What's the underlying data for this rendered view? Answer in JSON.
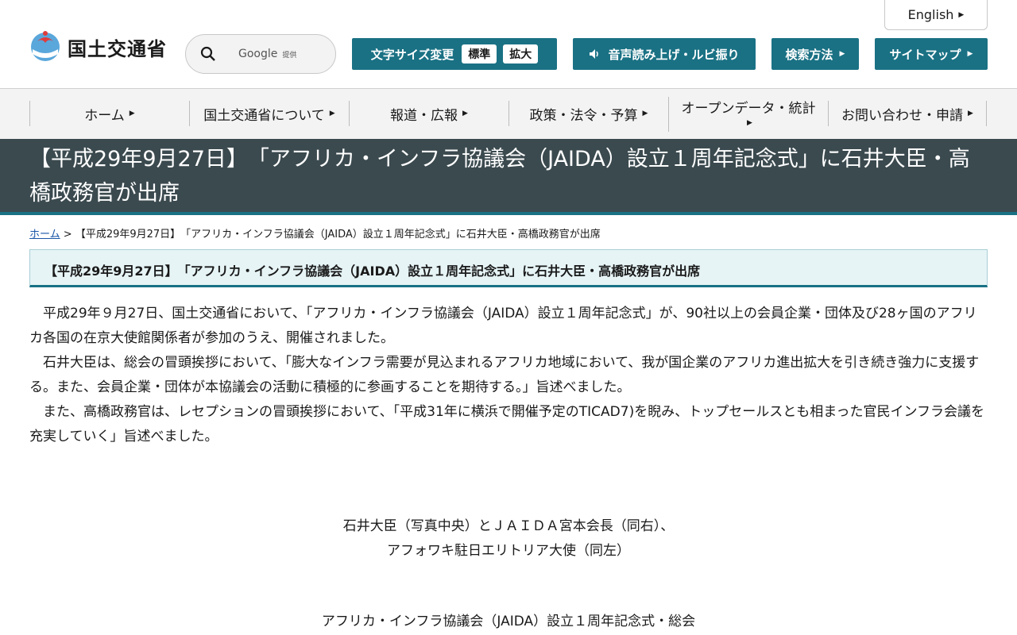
{
  "header": {
    "logo_text": "国土交通省",
    "search_provider": "Google",
    "search_provider_suffix": "提供",
    "english_label": "English",
    "text_size_label": "文字サイズ変更",
    "size_standard": "標準",
    "size_large": "拡大",
    "voice_label": "音声読み上げ・ルビ振り",
    "search_method_label": "検索方法",
    "sitemap_label": "サイトマップ"
  },
  "nav": {
    "items": [
      "ホーム",
      "国土交通省について",
      "報道・広報",
      "政策・法令・予算",
      "オープンデータ・統計",
      "お問い合わせ・申請"
    ]
  },
  "page": {
    "title": "【平成29年9月27日】　「アフリカ・インフラ協議会（JAIDA）設立１周年記念式」に石井大臣・高橋政務官が出席",
    "breadcrumb_home": "ホーム",
    "breadcrumb_sep": ">",
    "breadcrumb_current": "【平成29年9月27日】　「アフリカ・インフラ協議会（JAIDA）設立１周年記念式」に石井大臣・高橋政務官が出席",
    "section_heading": "【平成29年9月27日】　「アフリカ・インフラ協議会（JAIDA）設立１周年記念式」に石井大臣・高橋政務官が出席",
    "paragraphs": [
      "平成29年９月27日、国土交通省において、「アフリカ・インフラ協議会（JAIDA）設立１周年記念式」が、90社以上の会員企業・団体及び28ヶ国のアフリカ各国の在京大使館関係者が参加のうえ、開催されました。",
      "石井大臣は、総会の冒頭挨拶において、「膨大なインフラ需要が見込まれるアフリカ地域において、我が国企業のアフリカ進出拡大を引き続き強力に支援する。また、会員企業・団体が本協議会の活動に積極的に参画することを期待する。」旨述べました。",
      "また、高橋政務官は、レセプションの冒頭挨拶において、「平成31年に横浜で開催予定のTICAD7)を睨み、トップセールスとも相まった官民インフラ会議を充実していく」旨述べました。"
    ],
    "caption1_line1": "石井大臣（写真中央）とＪＡＩＤＡ宮本会長（同右）、",
    "caption1_line2": "アフォワキ駐日エリトリア大使（同左）",
    "caption2": "アフリカ・インフラ協議会（JAIDA）設立１周年記念式・総会"
  },
  "colors": {
    "teal": "#1a7184",
    "title_band": "#3b4a4f",
    "nav_bg": "#f3f3f3",
    "link": "#1a56a8"
  }
}
